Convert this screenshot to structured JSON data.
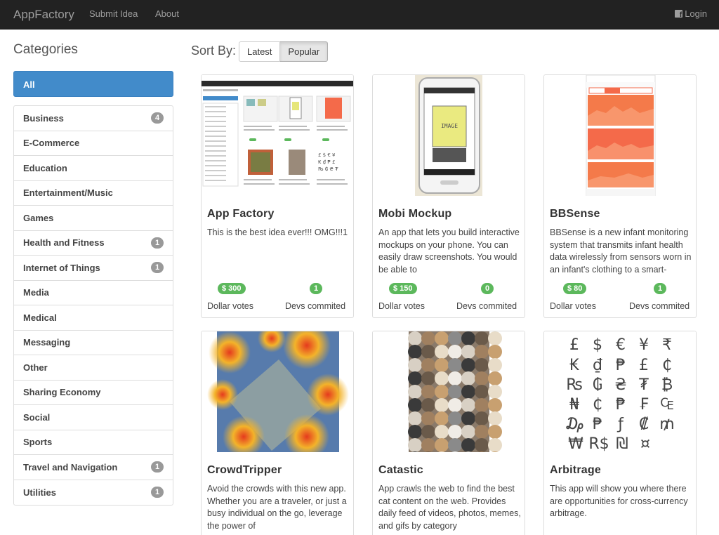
{
  "navbar": {
    "brand": "AppFactory",
    "links": [
      "Submit Idea",
      "About"
    ],
    "login": "Login"
  },
  "sidebar": {
    "title": "Categories",
    "all_label": "All",
    "items": [
      {
        "label": "Business",
        "count": "4"
      },
      {
        "label": "E-Commerce",
        "count": ""
      },
      {
        "label": "Education",
        "count": ""
      },
      {
        "label": "Entertainment/Music",
        "count": ""
      },
      {
        "label": "Games",
        "count": ""
      },
      {
        "label": "Health and Fitness",
        "count": "1"
      },
      {
        "label": "Internet of Things",
        "count": "1"
      },
      {
        "label": "Media",
        "count": ""
      },
      {
        "label": "Medical",
        "count": ""
      },
      {
        "label": "Messaging",
        "count": ""
      },
      {
        "label": "Other",
        "count": ""
      },
      {
        "label": "Sharing Economy",
        "count": ""
      },
      {
        "label": "Social",
        "count": ""
      },
      {
        "label": "Sports",
        "count": ""
      },
      {
        "label": "Travel and Navigation",
        "count": "1"
      },
      {
        "label": "Utilities",
        "count": "1"
      }
    ]
  },
  "sort": {
    "label": "Sort By:",
    "options": [
      "Latest",
      "Popular"
    ],
    "selected": "Popular"
  },
  "cards": [
    {
      "title": "App Factory",
      "description": "This is the best idea ever!!! OMG!!!1",
      "dollar_votes": "$ 300",
      "devs": "1",
      "dollar_label": "Dollar votes",
      "devs_label": "Devs commited",
      "image": "app-factory-screenshot"
    },
    {
      "title": "Mobi Mockup",
      "description": "An app that lets you build interactive mockups on your phone. You can easily draw screenshots. You would be able to",
      "dollar_votes": "$ 150",
      "devs": "0",
      "dollar_label": "Dollar votes",
      "devs_label": "Devs commited",
      "image": "phone-mockup",
      "image_text": "IMAGE"
    },
    {
      "title": "BBSense",
      "description": "BBSense is a new infant monitoring system that transmits infant health data wirelessly from sensors worn in an infant's clothing to a smart-",
      "dollar_votes": "$ 80",
      "devs": "1",
      "dollar_label": "Dollar votes",
      "devs_label": "Devs commited",
      "image": "health-dashboard"
    },
    {
      "title": "CrowdTripper",
      "description": "Avoid the crowds with this new app. Whether you are a traveler, or just a busy individual on the go, leverage the power of",
      "image": "crowd-heatmap"
    },
    {
      "title": "Catastic",
      "description": "App crawls the web to find the best cat content on the web. Provides daily feed of videos, photos, memes, and gifs by category",
      "image": "cat-collage"
    },
    {
      "title": "Arbitrage",
      "description": "This app will show you where there are opportunities for cross-currency arbitrage.",
      "image": "currency-symbols",
      "symbols": [
        "£",
        "$",
        "€",
        "¥",
        "₹",
        "₭",
        "₫",
        "₱",
        "£",
        "₵",
        "₨",
        "₲",
        "₴",
        "₮",
        "₿",
        "₦",
        "₵",
        "₱",
        "₣",
        "₠",
        "₯",
        "₱",
        "ƒ",
        "₡",
        "₥",
        "₩",
        "R$",
        "₪",
        "¤"
      ]
    }
  ],
  "colors": {
    "navbar": "#222222",
    "primary": "#428bca",
    "success": "#5cb85c",
    "badge": "#999999"
  }
}
